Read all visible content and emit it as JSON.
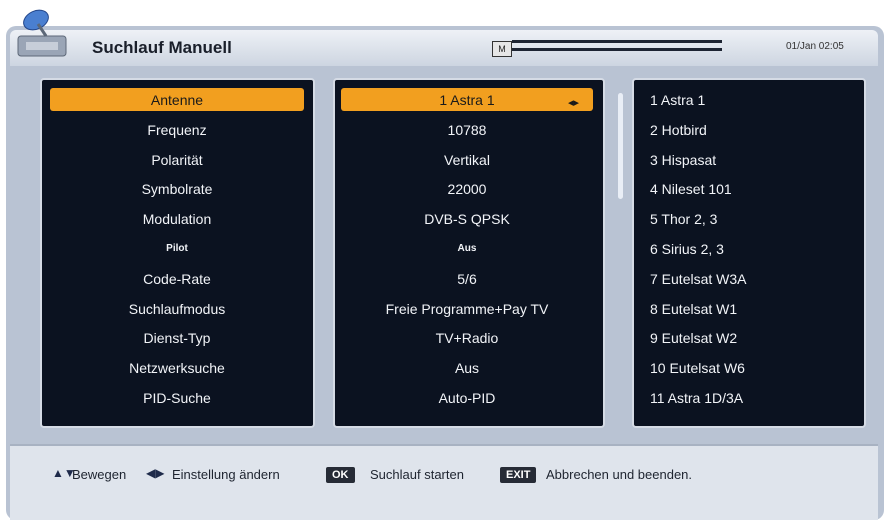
{
  "header": {
    "title": "Suchlauf Manuell",
    "datetime": "01/Jan 02:05",
    "signal_icon_label": "M"
  },
  "settings": {
    "labels": [
      "Antenne",
      "Frequenz",
      "Polarität",
      "Symbolrate",
      "Modulation",
      "Pilot",
      "Code-Rate",
      "Suchlaufmodus",
      "Dienst-Typ",
      "Netzwerksuche",
      "PID-Suche"
    ],
    "values": [
      "1 Astra 1",
      "10788",
      "Vertikal",
      "22000",
      "DVB-S QPSK",
      "Aus",
      "5/6",
      "Freie Programme+Pay TV",
      "TV+Radio",
      "Aus",
      "Auto-PID"
    ],
    "selected_index": 0
  },
  "satellites": [
    "1 Astra 1",
    "2 Hotbird",
    "3 Hispasat",
    "4 Nileset 101",
    "5 Thor 2, 3",
    "6 Sirius 2, 3",
    "7 Eutelsat W3A",
    "8 Eutelsat W1",
    "9 Eutelsat W2",
    "10 Eutelsat W6",
    "11 Astra 1D/3A"
  ],
  "footer": {
    "move": "Bewegen",
    "change": "Einstellung ändern",
    "ok_key": "OK",
    "ok_text": "Suchlauf starten",
    "exit_key": "EXIT",
    "exit_text": "Abbrechen und beenden."
  },
  "colors": {
    "highlight": "#f29f1f",
    "panel_bg": "#0b1220",
    "screen_bg": "#b9c3d3"
  }
}
